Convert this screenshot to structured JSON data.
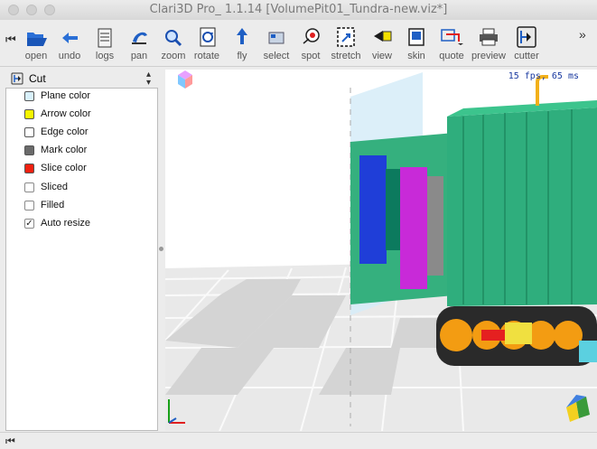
{
  "window": {
    "title": "Clari3D Pro_ 1.1.14 [VolumePit01_Tundra-new.viz*]"
  },
  "toolbar": {
    "tools": [
      {
        "id": "open",
        "label": "open",
        "icon": "folder-open-icon"
      },
      {
        "id": "undo",
        "label": "undo",
        "icon": "undo-arrow-icon"
      },
      {
        "id": "logs",
        "label": "logs",
        "icon": "log-document-icon"
      },
      {
        "id": "pan",
        "label": "pan",
        "icon": "hand-pan-icon"
      },
      {
        "id": "zoom",
        "label": "zoom",
        "icon": "magnifier-zoom-icon"
      },
      {
        "id": "rotate",
        "label": "rotate",
        "icon": "rotate-icon"
      },
      {
        "id": "fly",
        "label": "fly",
        "icon": "fly-arrow-icon"
      },
      {
        "id": "select",
        "label": "select",
        "icon": "select-icon"
      },
      {
        "id": "spot",
        "label": "spot",
        "icon": "spot-icon"
      },
      {
        "id": "stretch",
        "label": "stretch",
        "icon": "stretch-icon"
      },
      {
        "id": "view",
        "label": "view",
        "icon": "view-icon"
      },
      {
        "id": "skin",
        "label": "skin",
        "icon": "skin-icon"
      },
      {
        "id": "quote",
        "label": "quote",
        "icon": "quote-icon"
      },
      {
        "id": "preview",
        "label": "preview",
        "icon": "printer-preview-icon"
      },
      {
        "id": "cutter",
        "label": "cutter",
        "icon": "cutter-icon"
      }
    ]
  },
  "panel": {
    "mode": "Cut",
    "colors": [
      {
        "label": "Plane color",
        "color": "#d8f0fb"
      },
      {
        "label": "Arrow color",
        "color": "#f5f500"
      },
      {
        "label": "Edge color",
        "color": "#ffffff"
      },
      {
        "label": "Mark color",
        "color": "#6a6a6a"
      },
      {
        "label": "Slice color",
        "color": "#f02010"
      }
    ],
    "options": [
      {
        "label": "Sliced",
        "checked": false
      },
      {
        "label": "Filled",
        "checked": false
      },
      {
        "label": "Auto resize",
        "checked": true
      }
    ]
  },
  "viewport": {
    "fps": "15 fps, 65 ms"
  }
}
